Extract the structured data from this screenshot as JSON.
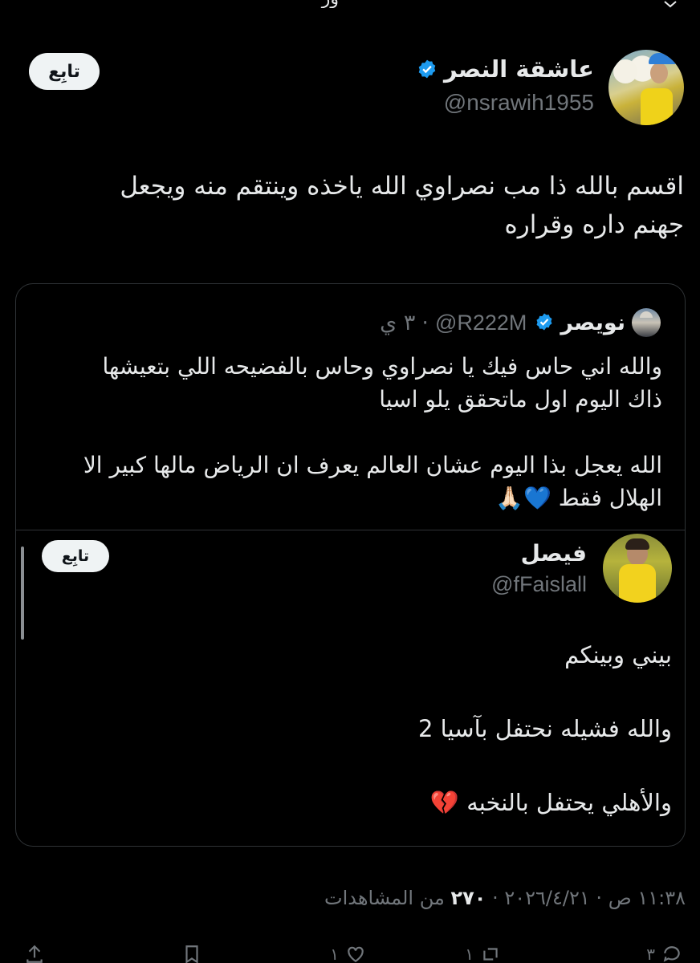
{
  "header_partial_text": "ور",
  "main_tweet": {
    "display_name": "عاشقة النصر",
    "handle": "@nsrawih1955",
    "follow_label": "تابِع",
    "text": "اقسم بالله ذا مب نصراوي الله ياخذه وينتقم منه ويجعل\nجهنم داره وقراره"
  },
  "quote": {
    "display_name": "نويصر",
    "handle": "@R222M",
    "separator": "·",
    "time": "٣ ي",
    "text": "والله اني حاس فيك يا نصراوي وحاس بالفضيحه اللي بتعيشها\nذاك اليوم اول ماتحقق يلو اسيا\n\nالله يعجل بذا اليوم عشان العالم يعرف ان الرياض مالها كبير الا\nالهلال فقط 💙🙏🏻"
  },
  "nested_quote": {
    "display_name": "فيصل",
    "handle": "@fFaislall",
    "follow_label": "تابِع",
    "text": "بيني وبينكم\n\nوالله فشيله نحتفل بآسيا 2\n\nوالأهلي يحتفل بالنخبه 💔"
  },
  "meta": {
    "time": "١١:٣٨ ص",
    "separator": "·",
    "date": "٢٠٢٦/٤/٢١",
    "views_count": "٢٧٠",
    "views_label": "من المشاهدات"
  },
  "actions": {
    "reply_count": "٣",
    "retweet_count": "١",
    "like_count": "١"
  },
  "colors": {
    "background": "#000000",
    "text": "#e7e9ea",
    "muted": "#71767b",
    "verified_blue": "#1d9bf0",
    "border": "#2f3336"
  }
}
